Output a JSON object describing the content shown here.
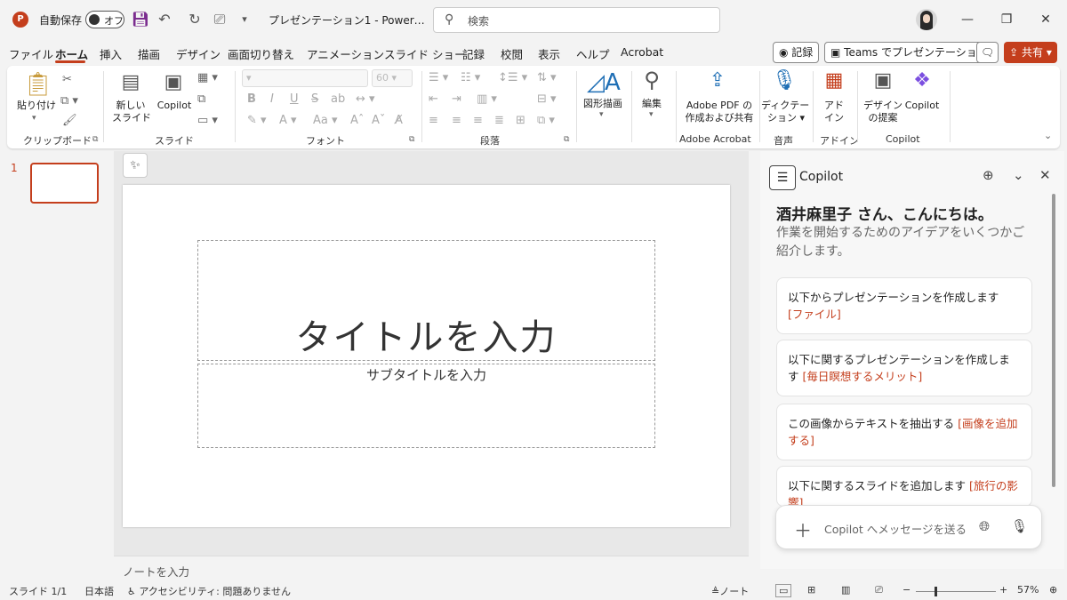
{
  "titlebar": {
    "app_logo": "P",
    "autosave_label": "自動保存",
    "autosave_state": "オフ",
    "doc_title": "プレゼンテーション1 - Power…",
    "search_placeholder": "検索",
    "icons": [
      "save-icon",
      "undo-icon",
      "redo-icon",
      "present-icon",
      "customize-icon"
    ]
  },
  "menu": {
    "tabs": [
      "ファイル",
      "ホーム",
      "挿入",
      "描画",
      "デザイン",
      "画面切り替え",
      "アニメーション",
      "スライド ショー",
      "記録",
      "校閲",
      "表示",
      "ヘルプ",
      "Acrobat"
    ],
    "active": "ホーム",
    "record_label": "記録",
    "teams_label": "Teams でプレゼンテーション",
    "share_label": "共有"
  },
  "ribbon": {
    "clipboard": {
      "paste_label": "貼り付け",
      "group_label": "クリップボード"
    },
    "slides": {
      "new_slide_label_1": "新しい",
      "new_slide_label_2": "スライド",
      "copilot_label": "Copilot",
      "group_label": "スライド"
    },
    "font": {
      "font_size": "60",
      "bold": "B",
      "italic": "I",
      "underline": "U",
      "strike": "S",
      "font_aa": "Aa",
      "grow": "A",
      "shrink": "A",
      "group_label": "フォント"
    },
    "paragraph": {
      "group_label": "段落"
    },
    "drawing": {
      "shapes_label": "図形描画"
    },
    "editing": {
      "edit_label": "編集"
    },
    "acrobat": {
      "label_1": "Adobe PDF の",
      "label_2": "作成および共有",
      "group_label": "Adobe Acrobat"
    },
    "voice": {
      "dictate_label_1": "ディクテー",
      "dictate_label_2": "ション",
      "group_label": "音声"
    },
    "addins": {
      "label_1": "アド",
      "label_2": "イン",
      "group_label": "アドイン"
    },
    "copilot": {
      "design_label_1": "デザイン",
      "design_label_2": "の提案",
      "copilot_label": "Copilot",
      "group_label": "Copilot"
    }
  },
  "thumbnails": {
    "slide_number": "1"
  },
  "slide": {
    "title_placeholder": "タイトルを入力",
    "subtitle_placeholder": "サブタイトルを入力"
  },
  "notes": {
    "placeholder": "ノートを入力"
  },
  "copilot": {
    "title": "Copilot",
    "greeting": "酒井麻里子 さん、こんにちは。",
    "subtitle": "作業を開始するためのアイデアをいくつかご紹介します。",
    "cards": [
      {
        "text": "以下からプレゼンテーションを作成します",
        "highlight": "[ファイル]"
      },
      {
        "text": "以下に関するプレゼンテーションを作成します",
        "highlight": "[毎日瞑想するメリット]"
      },
      {
        "text": "この画像からテキストを抽出する",
        "highlight": "[画像を追加する]"
      },
      {
        "text": "以下に関するスライドを追加します",
        "highlight": "[旅行の影響]"
      }
    ],
    "input_placeholder": "Copilot へメッセージを送る"
  },
  "status": {
    "slide_info": "スライド 1/1",
    "language": "日本語",
    "accessibility": "アクセシビリティ: 問題ありません",
    "notes_label": "ノート",
    "zoom": "57%",
    "zoom_fraction": 0.57
  },
  "colors": {
    "accent": "#c43e1c",
    "copilot_highlight": "#c43e1c"
  }
}
